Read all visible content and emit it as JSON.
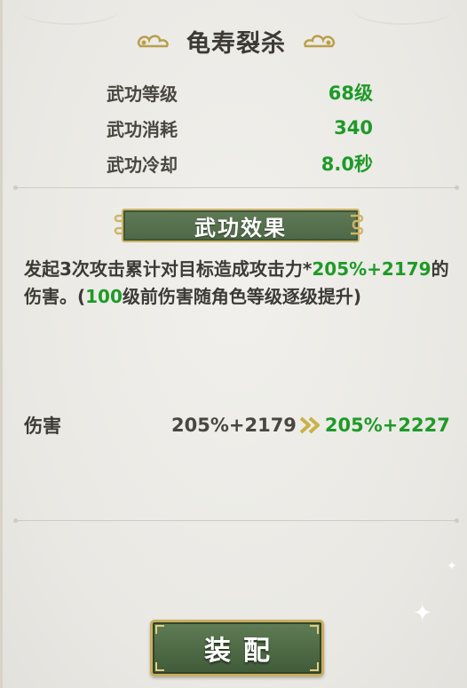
{
  "skill": {
    "name": "龟寿裂杀"
  },
  "stats": [
    {
      "label": "武功等级",
      "value": "68级"
    },
    {
      "label": "武功消耗",
      "value": "340"
    },
    {
      "label": "武功冷却",
      "value": "8.0秒"
    }
  ],
  "effect": {
    "banner": "武功效果",
    "desc_prefix": "发起3次攻击累计对目标造成攻击力*",
    "desc_formula": "205%+2179",
    "desc_mid": "的伤害。(",
    "desc_level": "100",
    "desc_suffix": "级前伤害随角色等级逐级提升)"
  },
  "damage": {
    "label": "伤害",
    "current": "205%+2179",
    "next": "205%+2227"
  },
  "equip_button": {
    "label": "装配"
  },
  "colors": {
    "highlight_green": "#1e9a28",
    "banner_green": "#4e6847",
    "gold_border": "#c9ad5e"
  }
}
